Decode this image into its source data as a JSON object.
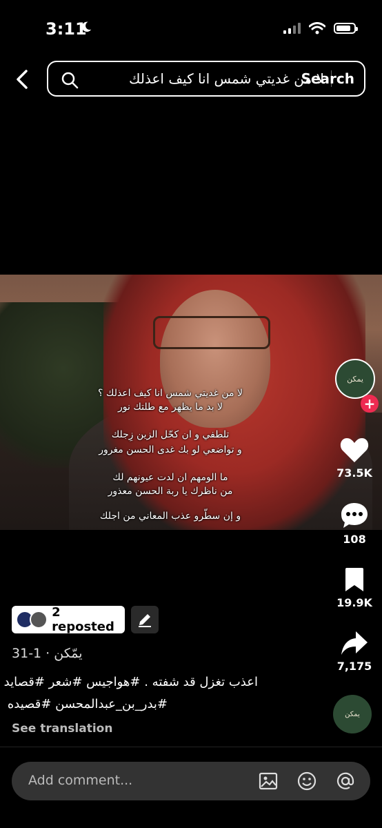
{
  "status_bar": {
    "time": "3:11"
  },
  "search": {
    "query": "لا من غديتي شمس انا كيف اعذلك",
    "button_label": "Search"
  },
  "video": {
    "lyrics": [
      "لا من غديتي شمس انا كيف اعذلك ؟",
      "لا بد ما يظهر مع طلتك نور",
      "تلطفي و ان كحّل الزين زِجلك",
      "و تواضعي لو بك غدى الحسن مغرور",
      "ما الومهم ان لدت عيونهم لك",
      "من ناظرك يا ربة الحسن معذور",
      "و إن سطّرو عذب المعاني من اجلك"
    ]
  },
  "profile": {
    "avatar_text": "يمكن"
  },
  "actions": {
    "likes": "73.5K",
    "comments": "108",
    "saves": "19.9K",
    "shares": "7,175"
  },
  "repost": {
    "label": "2 reposted"
  },
  "post": {
    "author_line": "يمّكن · 1-31",
    "caption_line1": "اعذب تغزل قد شفته . #هواجيس #شعر #قصايد",
    "caption_line2": "#بدر_بن_عبدالمحسن #قصيده",
    "see_translation": "See translation"
  },
  "music": {
    "disc_text": "يمكن"
  },
  "comment": {
    "placeholder": "Add comment..."
  },
  "colors": {
    "accent": "#ee2b51",
    "avatar_bg": "#2c4a33"
  }
}
